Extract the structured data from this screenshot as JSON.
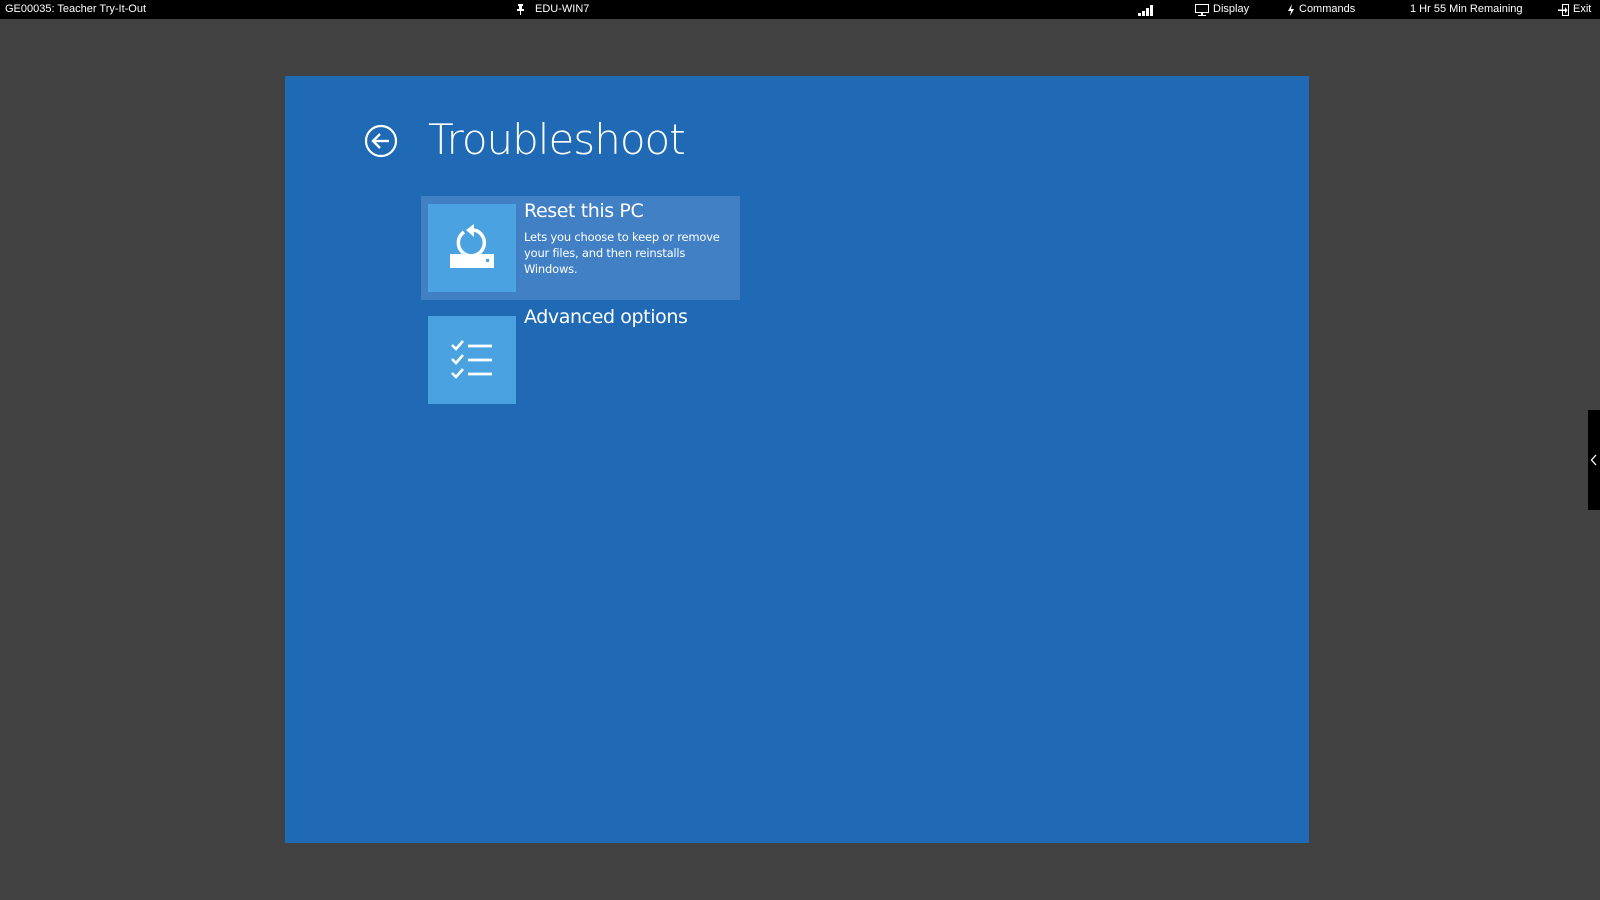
{
  "topbar": {
    "session_title": "GE00035: Teacher Try-It-Out",
    "pin_icon": "pin-icon",
    "machine_name": "EDU-WIN7",
    "signal_icon": "signal-bars-icon",
    "display_label": "Display",
    "commands_label": "Commands",
    "time_remaining": "1 Hr 55 Min Remaining",
    "exit_label": "Exit"
  },
  "screen": {
    "background_color": "#1f69b5",
    "back_icon": "back-arrow-circle-icon",
    "title": "Troubleshoot",
    "options": [
      {
        "title": "Reset this PC",
        "description": "Lets you choose to keep or remove your files, and then reinstalls Windows.",
        "icon": "reset-pc-icon",
        "selected": true
      },
      {
        "title": "Advanced options",
        "description": "",
        "icon": "checklist-icon",
        "selected": false
      }
    ]
  },
  "side_panel": {
    "icon": "chevron-left-icon"
  }
}
